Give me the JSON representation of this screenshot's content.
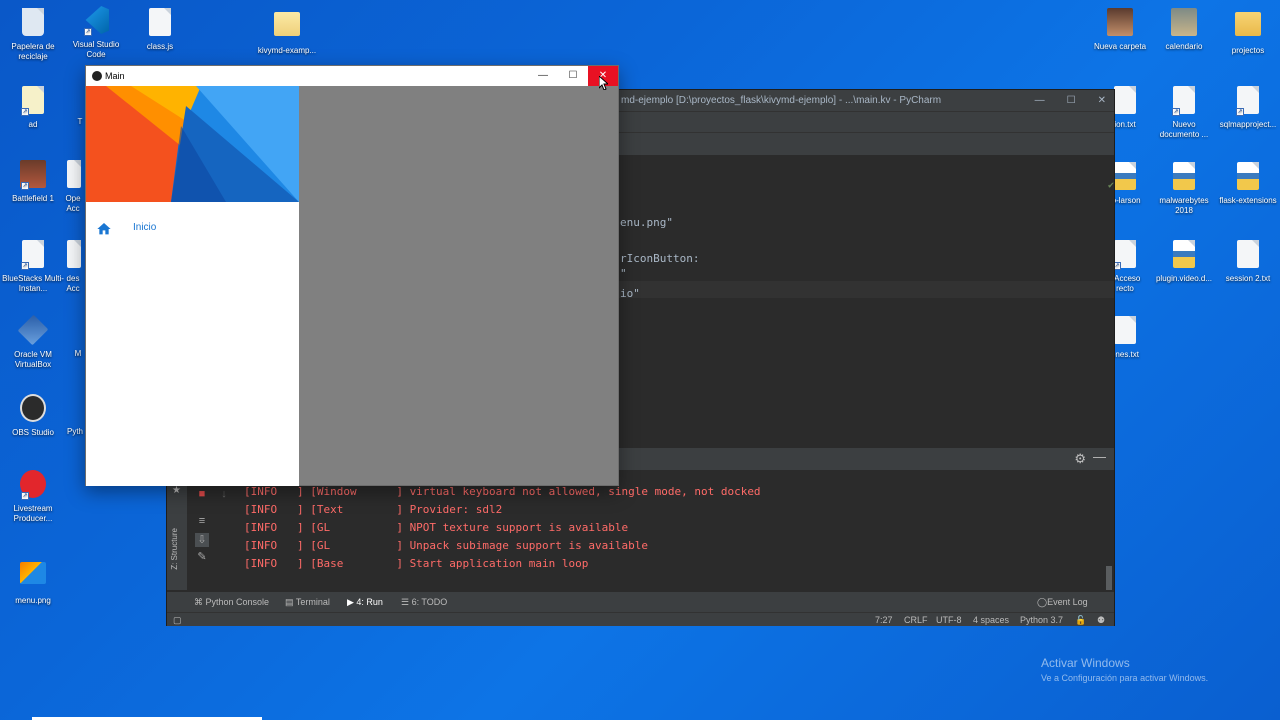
{
  "desktop": {
    "left_icons": [
      {
        "label": "Papelera de reciclaje",
        "icon": "recycle-bin-icon"
      },
      {
        "label": "Visual Studio Code",
        "icon": "vscode-icon"
      },
      {
        "label": "class.js",
        "icon": "file-icon"
      },
      {
        "label": "kivymd-examp...",
        "icon": "folder-icon"
      },
      {
        "label": "ad",
        "icon": "file-icon"
      },
      {
        "label": "Battlefield 1",
        "icon": "game-icon"
      },
      {
        "label": "BlueStacks Multi-Instan...",
        "icon": "file-icon"
      },
      {
        "label": "Oracle VM VirtualBox",
        "icon": "virtualbox-icon"
      },
      {
        "label": "OBS Studio",
        "icon": "obs-icon"
      },
      {
        "label": "Livestream Producer...",
        "icon": "livestream-icon"
      },
      {
        "label": "menu.png",
        "icon": "image-file-icon"
      }
    ],
    "partial_labels": [
      "T",
      "Ope Acc",
      "des Acc",
      "M",
      "Pyth"
    ],
    "right_icons": [
      {
        "label": "Nueva carpeta",
        "icon": "folder-icon"
      },
      {
        "label": "calendario",
        "icon": "folder-icon"
      },
      {
        "label": "projectos",
        "icon": "folder-icon"
      },
      {
        "label": "ion.txt",
        "icon": "text-file-icon"
      },
      {
        "label": "Nuevo documento ...",
        "icon": "text-file-icon"
      },
      {
        "label": "sqlmapproject...",
        "icon": "text-file-icon"
      },
      {
        "label": "to-larson",
        "icon": "python-file-icon"
      },
      {
        "label": "malwarebytes 2018",
        "icon": "python-file-icon"
      },
      {
        "label": "flask-extensions",
        "icon": "python-file-icon"
      },
      {
        "label": "- Acceso recto",
        "icon": "shortcut-icon"
      },
      {
        "label": "plugin.video.d...",
        "icon": "python-file-icon"
      },
      {
        "label": "session 2.txt",
        "icon": "text-file-icon"
      },
      {
        "label": "ones.txt",
        "icon": "text-file-icon"
      }
    ]
  },
  "pycharm": {
    "title": "md-ejemplo [D:\\proyectos_flask\\kivymd-ejemplo] - ...\\main.kv - PyCharm",
    "window_controls": [
      "—",
      "☐",
      "✕"
    ],
    "code_lines": [
      {
        "text": "enu.png\""
      },
      {
        "text": "rIconButton:"
      },
      {
        "text": "\""
      },
      {
        "text": "io\""
      }
    ],
    "console_lines": [
      "[INFO   ] [Window      ] virtual keyboard not allowed, single mode, not docked",
      "[INFO   ] [Text        ] Provider: sdl2",
      "[INFO   ] [GL          ] NPOT texture support is available",
      "[INFO   ] [GL          ] Unpack subimage support is available",
      "[INFO   ] [Base        ] Start application main loop"
    ],
    "side_label": "Z: Structure",
    "bottom_tabs": {
      "python_console": "Python Console",
      "terminal": "Terminal",
      "run": "4: Run",
      "todo": "6: TODO",
      "event_log": "Event Log"
    },
    "status": {
      "position": "7:27",
      "line_sep": "CRLF",
      "encoding": "UTF-8",
      "indent": "4 spaces",
      "interpreter": "Python 3.7"
    }
  },
  "main_window": {
    "title": "Main",
    "controls": {
      "minimize": "—",
      "maximize": "☐",
      "close": "✕"
    },
    "drawer": {
      "items": [
        {
          "label": "Inicio",
          "icon": "home-icon"
        }
      ]
    }
  },
  "watermark": {
    "line1": "Activar Windows",
    "line2": "Ve a Configuración para activar Windows."
  },
  "colors": {
    "desktop": "#0b66d8",
    "close_button": "#e81123",
    "drawer_accent": "#1976d2",
    "console_text": "#ff6b68"
  }
}
